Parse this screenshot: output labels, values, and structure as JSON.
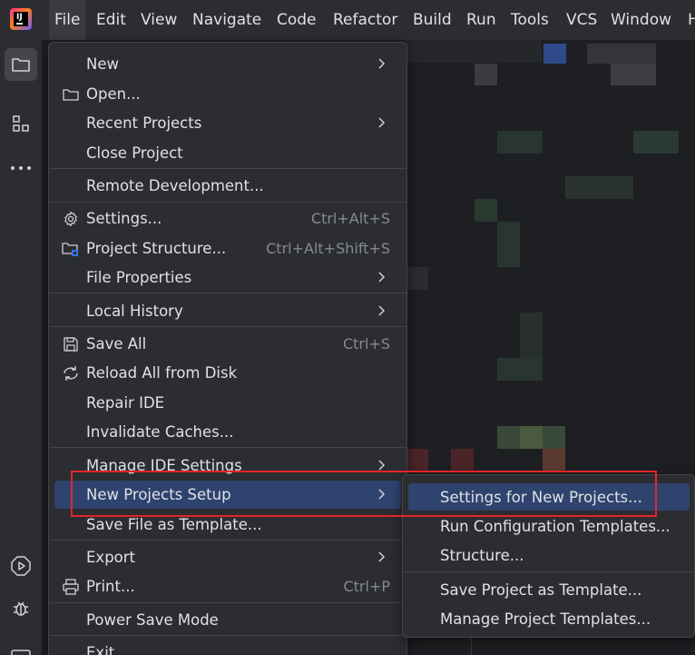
{
  "menubar": {
    "items": [
      {
        "label": "File",
        "active": true
      },
      {
        "label": "Edit"
      },
      {
        "label": "View"
      },
      {
        "label": "Navigate"
      },
      {
        "label": "Code"
      },
      {
        "label": "Refactor"
      },
      {
        "label": "Build"
      },
      {
        "label": "Run"
      },
      {
        "label": "Tools"
      },
      {
        "label": "VCS"
      },
      {
        "label": "Window"
      },
      {
        "label": "H"
      }
    ]
  },
  "tool_strip": {
    "icons": [
      "folder-icon",
      "structure-icon",
      "more-icon",
      "services-icon",
      "debug-icon",
      "terminal-icon"
    ]
  },
  "file_menu": {
    "items": [
      {
        "label": "New",
        "submenu": true
      },
      {
        "label": "Open...",
        "icon": "folder-icon"
      },
      {
        "label": "Recent Projects",
        "submenu": true
      },
      {
        "label": "Close Project"
      },
      {
        "label": "Remote Development..."
      },
      {
        "label": "Settings...",
        "icon": "gear-icon",
        "shortcut": "Ctrl+Alt+S"
      },
      {
        "label": "Project Structure...",
        "icon": "project-structure-icon",
        "shortcut": "Ctrl+Alt+Shift+S"
      },
      {
        "label": "File Properties",
        "submenu": true
      },
      {
        "label": "Local History",
        "submenu": true
      },
      {
        "label": "Save All",
        "icon": "save-icon",
        "shortcut": "Ctrl+S"
      },
      {
        "label": "Reload All from Disk",
        "icon": "reload-icon"
      },
      {
        "label": "Repair IDE"
      },
      {
        "label": "Invalidate Caches..."
      },
      {
        "label": "Manage IDE Settings",
        "submenu": true
      },
      {
        "label": "New Projects Setup",
        "submenu": true,
        "selected": true
      },
      {
        "label": "Save File as Template..."
      },
      {
        "label": "Export",
        "submenu": true
      },
      {
        "label": "Print...",
        "icon": "print-icon",
        "shortcut": "Ctrl+P"
      },
      {
        "label": "Power Save Mode"
      },
      {
        "label": "Exit"
      }
    ]
  },
  "sub_menu": {
    "items": [
      {
        "label": "Settings for New Projects...",
        "selected": true
      },
      {
        "label": "Run Configuration Templates..."
      },
      {
        "label": "Structure..."
      },
      {
        "label": "Save Project as Template..."
      },
      {
        "label": "Manage Project Templates..."
      }
    ]
  },
  "colors": {
    "background": "#1e1f22",
    "panel": "#2b2d30",
    "selection": "#2e436e",
    "annotation": "#e0262c"
  }
}
